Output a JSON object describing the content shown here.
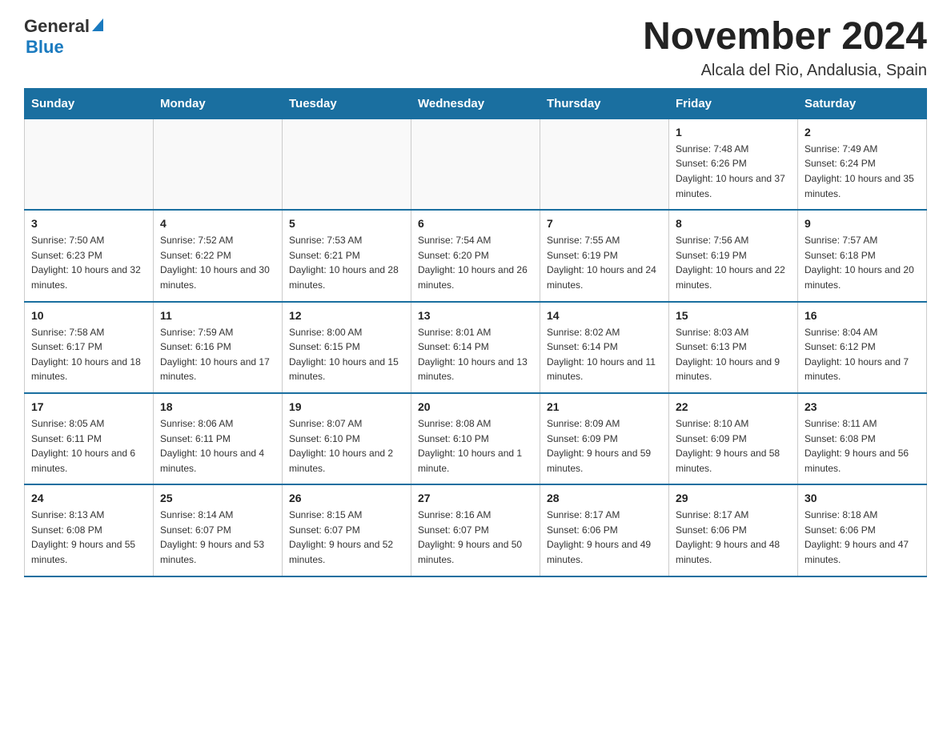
{
  "header": {
    "logo_general": "General",
    "logo_blue": "Blue",
    "month_title": "November 2024",
    "location": "Alcala del Rio, Andalusia, Spain"
  },
  "days_of_week": [
    "Sunday",
    "Monday",
    "Tuesday",
    "Wednesday",
    "Thursday",
    "Friday",
    "Saturday"
  ],
  "weeks": [
    [
      {
        "day": "",
        "info": ""
      },
      {
        "day": "",
        "info": ""
      },
      {
        "day": "",
        "info": ""
      },
      {
        "day": "",
        "info": ""
      },
      {
        "day": "",
        "info": ""
      },
      {
        "day": "1",
        "info": "Sunrise: 7:48 AM\nSunset: 6:26 PM\nDaylight: 10 hours and 37 minutes."
      },
      {
        "day": "2",
        "info": "Sunrise: 7:49 AM\nSunset: 6:24 PM\nDaylight: 10 hours and 35 minutes."
      }
    ],
    [
      {
        "day": "3",
        "info": "Sunrise: 7:50 AM\nSunset: 6:23 PM\nDaylight: 10 hours and 32 minutes."
      },
      {
        "day": "4",
        "info": "Sunrise: 7:52 AM\nSunset: 6:22 PM\nDaylight: 10 hours and 30 minutes."
      },
      {
        "day": "5",
        "info": "Sunrise: 7:53 AM\nSunset: 6:21 PM\nDaylight: 10 hours and 28 minutes."
      },
      {
        "day": "6",
        "info": "Sunrise: 7:54 AM\nSunset: 6:20 PM\nDaylight: 10 hours and 26 minutes."
      },
      {
        "day": "7",
        "info": "Sunrise: 7:55 AM\nSunset: 6:19 PM\nDaylight: 10 hours and 24 minutes."
      },
      {
        "day": "8",
        "info": "Sunrise: 7:56 AM\nSunset: 6:19 PM\nDaylight: 10 hours and 22 minutes."
      },
      {
        "day": "9",
        "info": "Sunrise: 7:57 AM\nSunset: 6:18 PM\nDaylight: 10 hours and 20 minutes."
      }
    ],
    [
      {
        "day": "10",
        "info": "Sunrise: 7:58 AM\nSunset: 6:17 PM\nDaylight: 10 hours and 18 minutes."
      },
      {
        "day": "11",
        "info": "Sunrise: 7:59 AM\nSunset: 6:16 PM\nDaylight: 10 hours and 17 minutes."
      },
      {
        "day": "12",
        "info": "Sunrise: 8:00 AM\nSunset: 6:15 PM\nDaylight: 10 hours and 15 minutes."
      },
      {
        "day": "13",
        "info": "Sunrise: 8:01 AM\nSunset: 6:14 PM\nDaylight: 10 hours and 13 minutes."
      },
      {
        "day": "14",
        "info": "Sunrise: 8:02 AM\nSunset: 6:14 PM\nDaylight: 10 hours and 11 minutes."
      },
      {
        "day": "15",
        "info": "Sunrise: 8:03 AM\nSunset: 6:13 PM\nDaylight: 10 hours and 9 minutes."
      },
      {
        "day": "16",
        "info": "Sunrise: 8:04 AM\nSunset: 6:12 PM\nDaylight: 10 hours and 7 minutes."
      }
    ],
    [
      {
        "day": "17",
        "info": "Sunrise: 8:05 AM\nSunset: 6:11 PM\nDaylight: 10 hours and 6 minutes."
      },
      {
        "day": "18",
        "info": "Sunrise: 8:06 AM\nSunset: 6:11 PM\nDaylight: 10 hours and 4 minutes."
      },
      {
        "day": "19",
        "info": "Sunrise: 8:07 AM\nSunset: 6:10 PM\nDaylight: 10 hours and 2 minutes."
      },
      {
        "day": "20",
        "info": "Sunrise: 8:08 AM\nSunset: 6:10 PM\nDaylight: 10 hours and 1 minute."
      },
      {
        "day": "21",
        "info": "Sunrise: 8:09 AM\nSunset: 6:09 PM\nDaylight: 9 hours and 59 minutes."
      },
      {
        "day": "22",
        "info": "Sunrise: 8:10 AM\nSunset: 6:09 PM\nDaylight: 9 hours and 58 minutes."
      },
      {
        "day": "23",
        "info": "Sunrise: 8:11 AM\nSunset: 6:08 PM\nDaylight: 9 hours and 56 minutes."
      }
    ],
    [
      {
        "day": "24",
        "info": "Sunrise: 8:13 AM\nSunset: 6:08 PM\nDaylight: 9 hours and 55 minutes."
      },
      {
        "day": "25",
        "info": "Sunrise: 8:14 AM\nSunset: 6:07 PM\nDaylight: 9 hours and 53 minutes."
      },
      {
        "day": "26",
        "info": "Sunrise: 8:15 AM\nSunset: 6:07 PM\nDaylight: 9 hours and 52 minutes."
      },
      {
        "day": "27",
        "info": "Sunrise: 8:16 AM\nSunset: 6:07 PM\nDaylight: 9 hours and 50 minutes."
      },
      {
        "day": "28",
        "info": "Sunrise: 8:17 AM\nSunset: 6:06 PM\nDaylight: 9 hours and 49 minutes."
      },
      {
        "day": "29",
        "info": "Sunrise: 8:17 AM\nSunset: 6:06 PM\nDaylight: 9 hours and 48 minutes."
      },
      {
        "day": "30",
        "info": "Sunrise: 8:18 AM\nSunset: 6:06 PM\nDaylight: 9 hours and 47 minutes."
      }
    ]
  ]
}
